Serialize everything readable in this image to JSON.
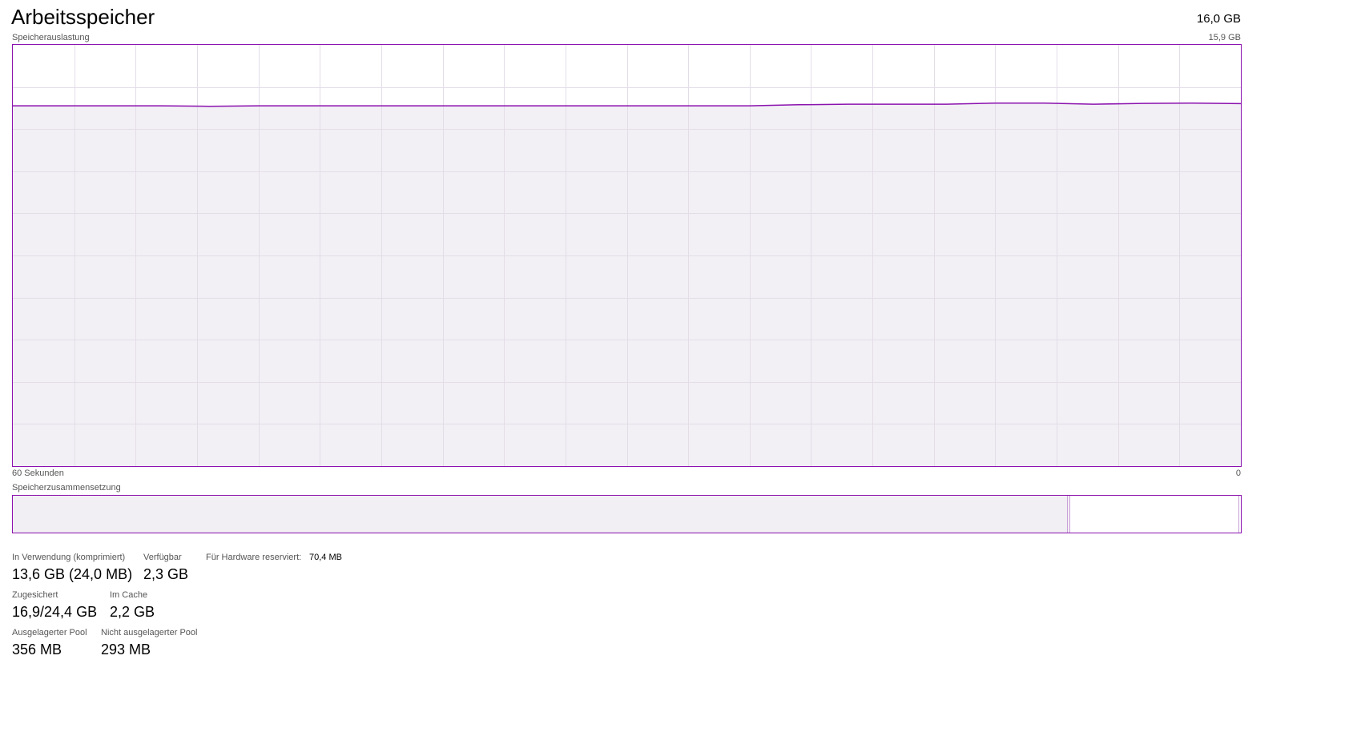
{
  "header": {
    "title": "Arbeitsspeicher",
    "total": "16,0 GB"
  },
  "usage_graph": {
    "label": "Speicherauslastung",
    "max_label": "15,9 GB",
    "time_left_label": "60 Sekunden",
    "time_right_label": "0",
    "line_color": "#8b12ae",
    "fill_color": "#f1eef4",
    "grid_color": "#e3dde8",
    "max_gb": 15.9,
    "samples_gb": [
      13.6,
      13.6,
      13.6,
      13.6,
      13.58,
      13.6,
      13.6,
      13.6,
      13.6,
      13.6,
      13.6,
      13.6,
      13.6,
      13.6,
      13.6,
      13.6,
      13.64,
      13.66,
      13.66,
      13.66,
      13.7,
      13.7,
      13.66,
      13.69,
      13.7,
      13.68
    ]
  },
  "composition": {
    "label": "Speicherzusammensetzung"
  },
  "stats": {
    "in_use_label": "In Verwendung (komprimiert)",
    "in_use_value": "13,6 GB (24,0 MB)",
    "available_label": "Verfügbar",
    "available_value": "2,3 GB",
    "hw_reserved_label": "Für Hardware reserviert:",
    "hw_reserved_value": "70,4 MB",
    "committed_label": "Zugesichert",
    "committed_value": "16,9/24,4 GB",
    "cached_label": "Im Cache",
    "cached_value": "2,2 GB",
    "paged_pool_label": "Ausgelagerter Pool",
    "paged_pool_value": "356 MB",
    "nonpaged_pool_label": "Nicht ausgelagerter Pool",
    "nonpaged_pool_value": "293 MB"
  }
}
